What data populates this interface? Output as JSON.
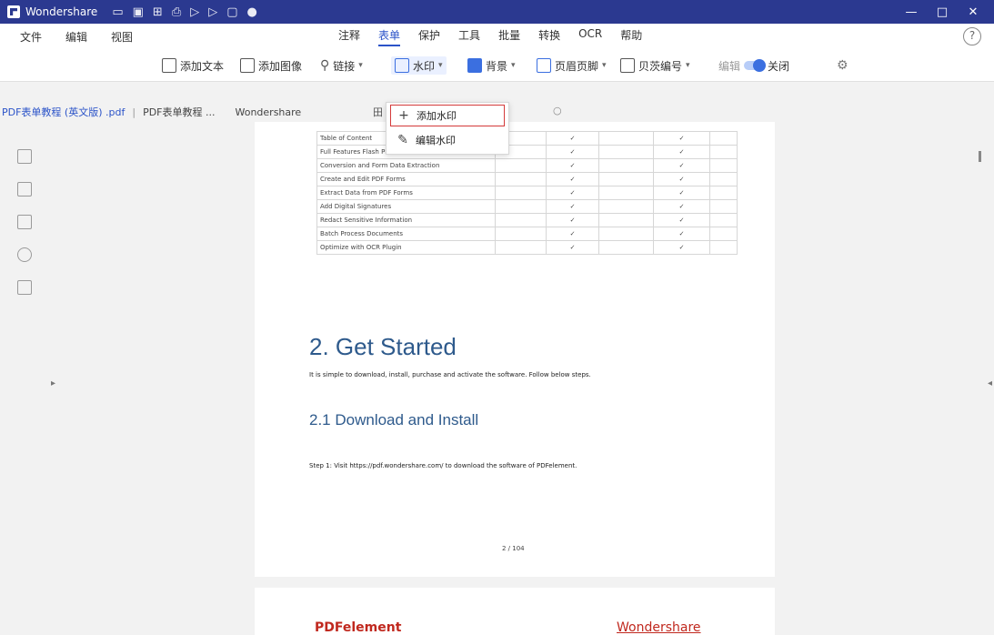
{
  "titlebar": {
    "app_name": "Wondershare",
    "quick_access": [
      "▭",
      "▣",
      "⊞",
      "⎙",
      "▷",
      "▷",
      "▢",
      "●"
    ],
    "window_controls": [
      "—",
      "□",
      "✕"
    ]
  },
  "menubar": {
    "left_items": [
      "文件",
      "编辑",
      "视图"
    ],
    "center_items": [
      "注释",
      "表单",
      "保护",
      "工具",
      "批量",
      "转换",
      "OCR",
      "帮助"
    ],
    "active_item": "表单",
    "help_icon": "?"
  },
  "toolbar": {
    "items": [
      "添加文本",
      "添加图像",
      "链接",
      "水印",
      "背景",
      "页眉页脚",
      "贝茨编号",
      "编辑",
      "关闭"
    ]
  },
  "tabbar": {
    "tab1": "PDF表单教程 (英文版) .pdf",
    "tab2": "PDF表单教程 ...",
    "tab3": "Wondershare",
    "close": "×"
  },
  "popup": {
    "item1": "添加水印",
    "item2": "编辑水印",
    "marker": "田",
    "tail": "○"
  },
  "document": {
    "table_rows": [
      {
        "name": "Table of Content",
        "c2": "✓",
        "c4": "✓"
      },
      {
        "name": "Full Features Flash PDF Editor",
        "c2": "✓",
        "c4": "✓"
      },
      {
        "name": "Conversion and Form Data Extraction",
        "c2": "✓",
        "c4": "✓"
      },
      {
        "name": "Create and Edit PDF Forms",
        "c2": "✓",
        "c4": "✓"
      },
      {
        "name": "Extract Data from PDF Forms",
        "c2": "✓",
        "c4": "✓"
      },
      {
        "name": "Add Digital Signatures",
        "c2": "✓",
        "c4": "✓"
      },
      {
        "name": "Redact Sensitive Information",
        "c2": "✓",
        "c4": "✓"
      },
      {
        "name": "Batch Process Documents",
        "c2": "✓",
        "c4": "✓"
      },
      {
        "name": "Optimize with OCR Plugin",
        "c2": "✓",
        "c4": "✓"
      }
    ],
    "heading": "2. Get Started",
    "intro": "It is simple to download, install, purchase and activate the software. Follow below steps.",
    "subheading": "2.1 Download and Install",
    "step": "Step 1: Visit https://pdf.wondershare.com/ to download the software of PDFelement.",
    "page_number": "2 / 104",
    "next_brand_left": "PDFelement",
    "next_brand_right": "Wondershare"
  },
  "colors": {
    "titlebar": "#2b3990",
    "accent": "#2b53c8",
    "popup_highlight": "#d43a3a"
  }
}
